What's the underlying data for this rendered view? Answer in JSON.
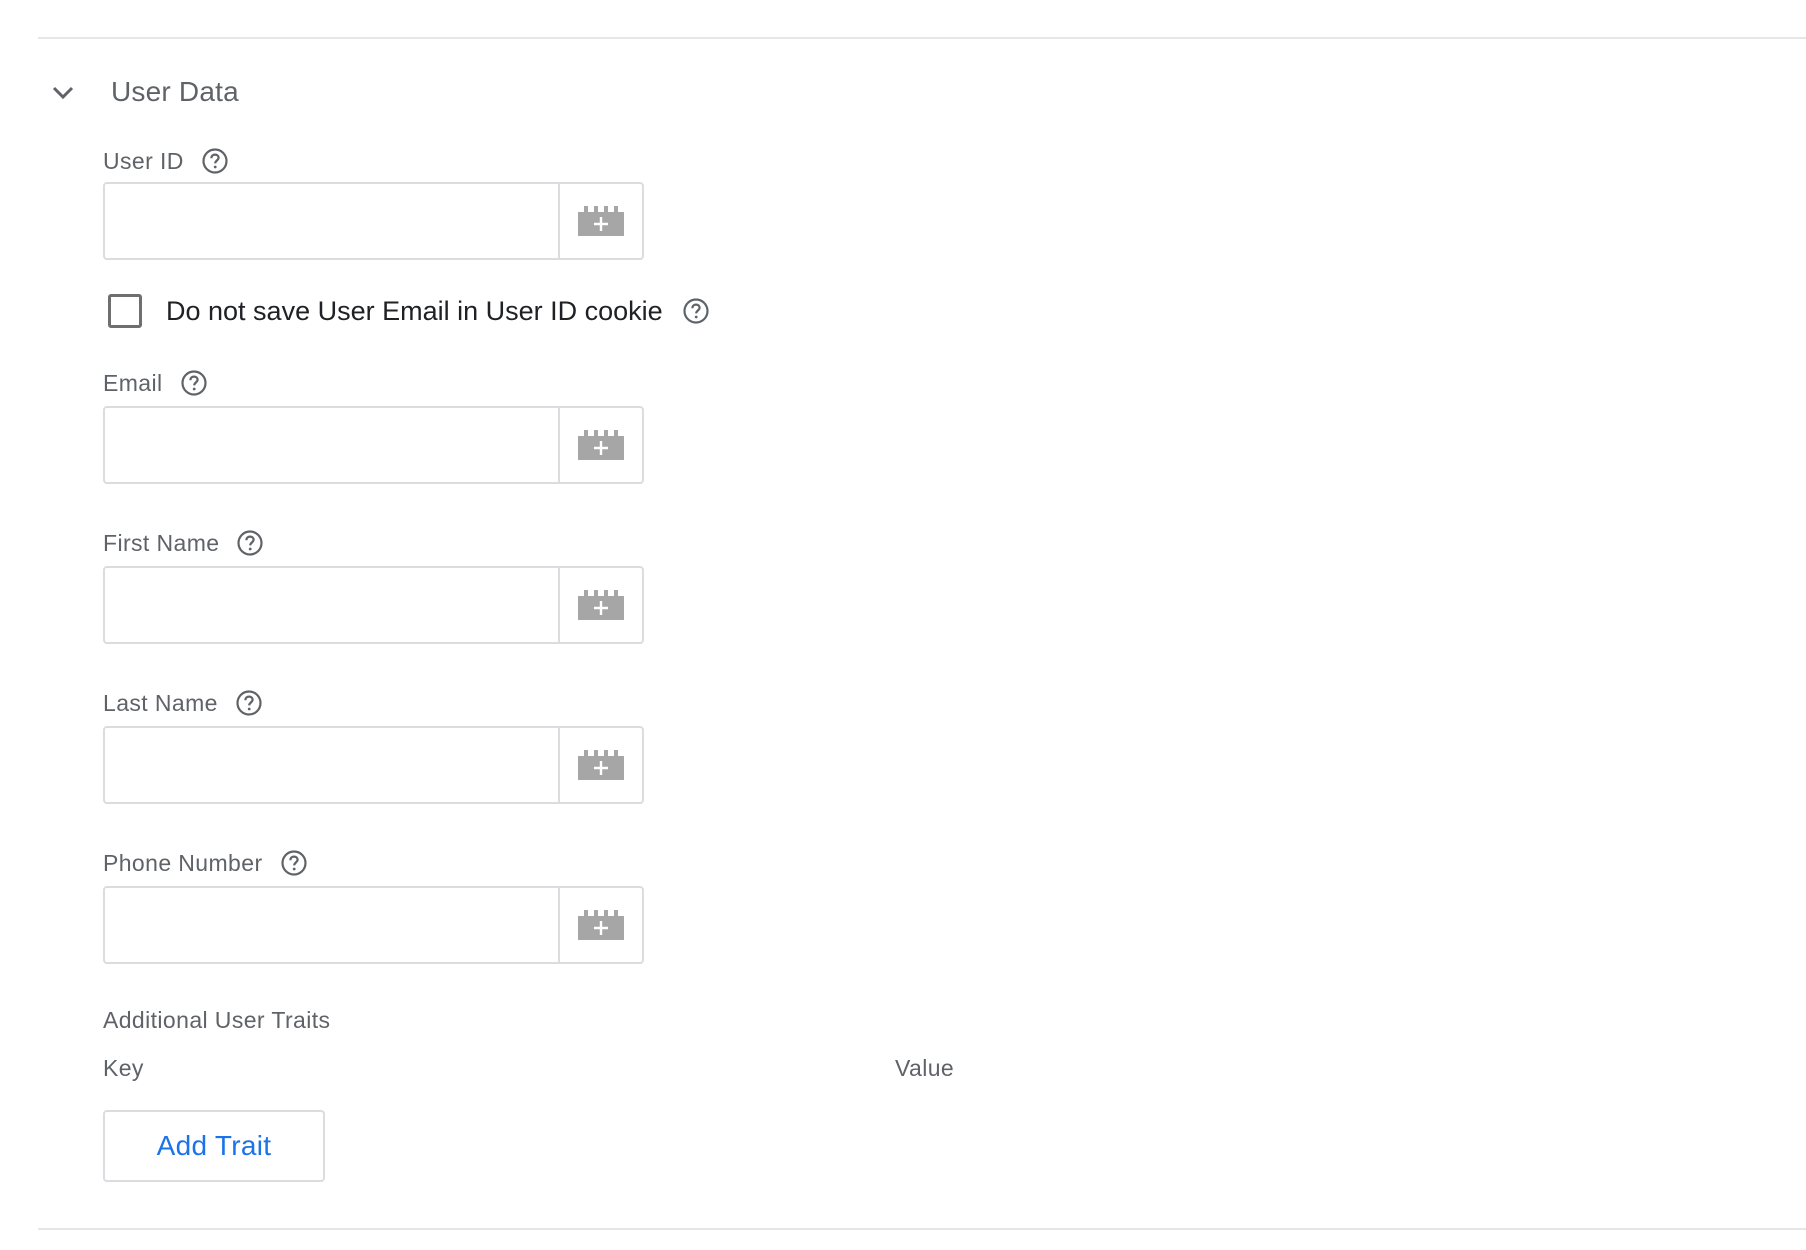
{
  "section": {
    "title": "User Data",
    "collapse_icon": "chevron-down-icon"
  },
  "fields": {
    "user_id": {
      "label": "User ID",
      "value": "",
      "help_icon": "help-circle-icon",
      "variable_icon": "add-variable-icon"
    },
    "email": {
      "label": "Email",
      "value": "",
      "help_icon": "help-circle-icon",
      "variable_icon": "add-variable-icon"
    },
    "first_name": {
      "label": "First Name",
      "value": "",
      "help_icon": "help-circle-icon",
      "variable_icon": "add-variable-icon"
    },
    "last_name": {
      "label": "Last Name",
      "value": "",
      "help_icon": "help-circle-icon",
      "variable_icon": "add-variable-icon"
    },
    "phone_number": {
      "label": "Phone Number",
      "value": "",
      "help_icon": "help-circle-icon",
      "variable_icon": "add-variable-icon"
    }
  },
  "checkbox": {
    "label": "Do not save User Email in User ID cookie",
    "checked": false,
    "help_icon": "help-circle-icon"
  },
  "traits": {
    "title": "Additional User Traits",
    "key_header": "Key",
    "value_header": "Value",
    "add_button": "Add Trait"
  },
  "colors": {
    "accent": "#1a73e8",
    "text_secondary": "#5f6368",
    "text_primary": "#202124",
    "border": "#dadce0",
    "icon": "#a6a6a6"
  }
}
